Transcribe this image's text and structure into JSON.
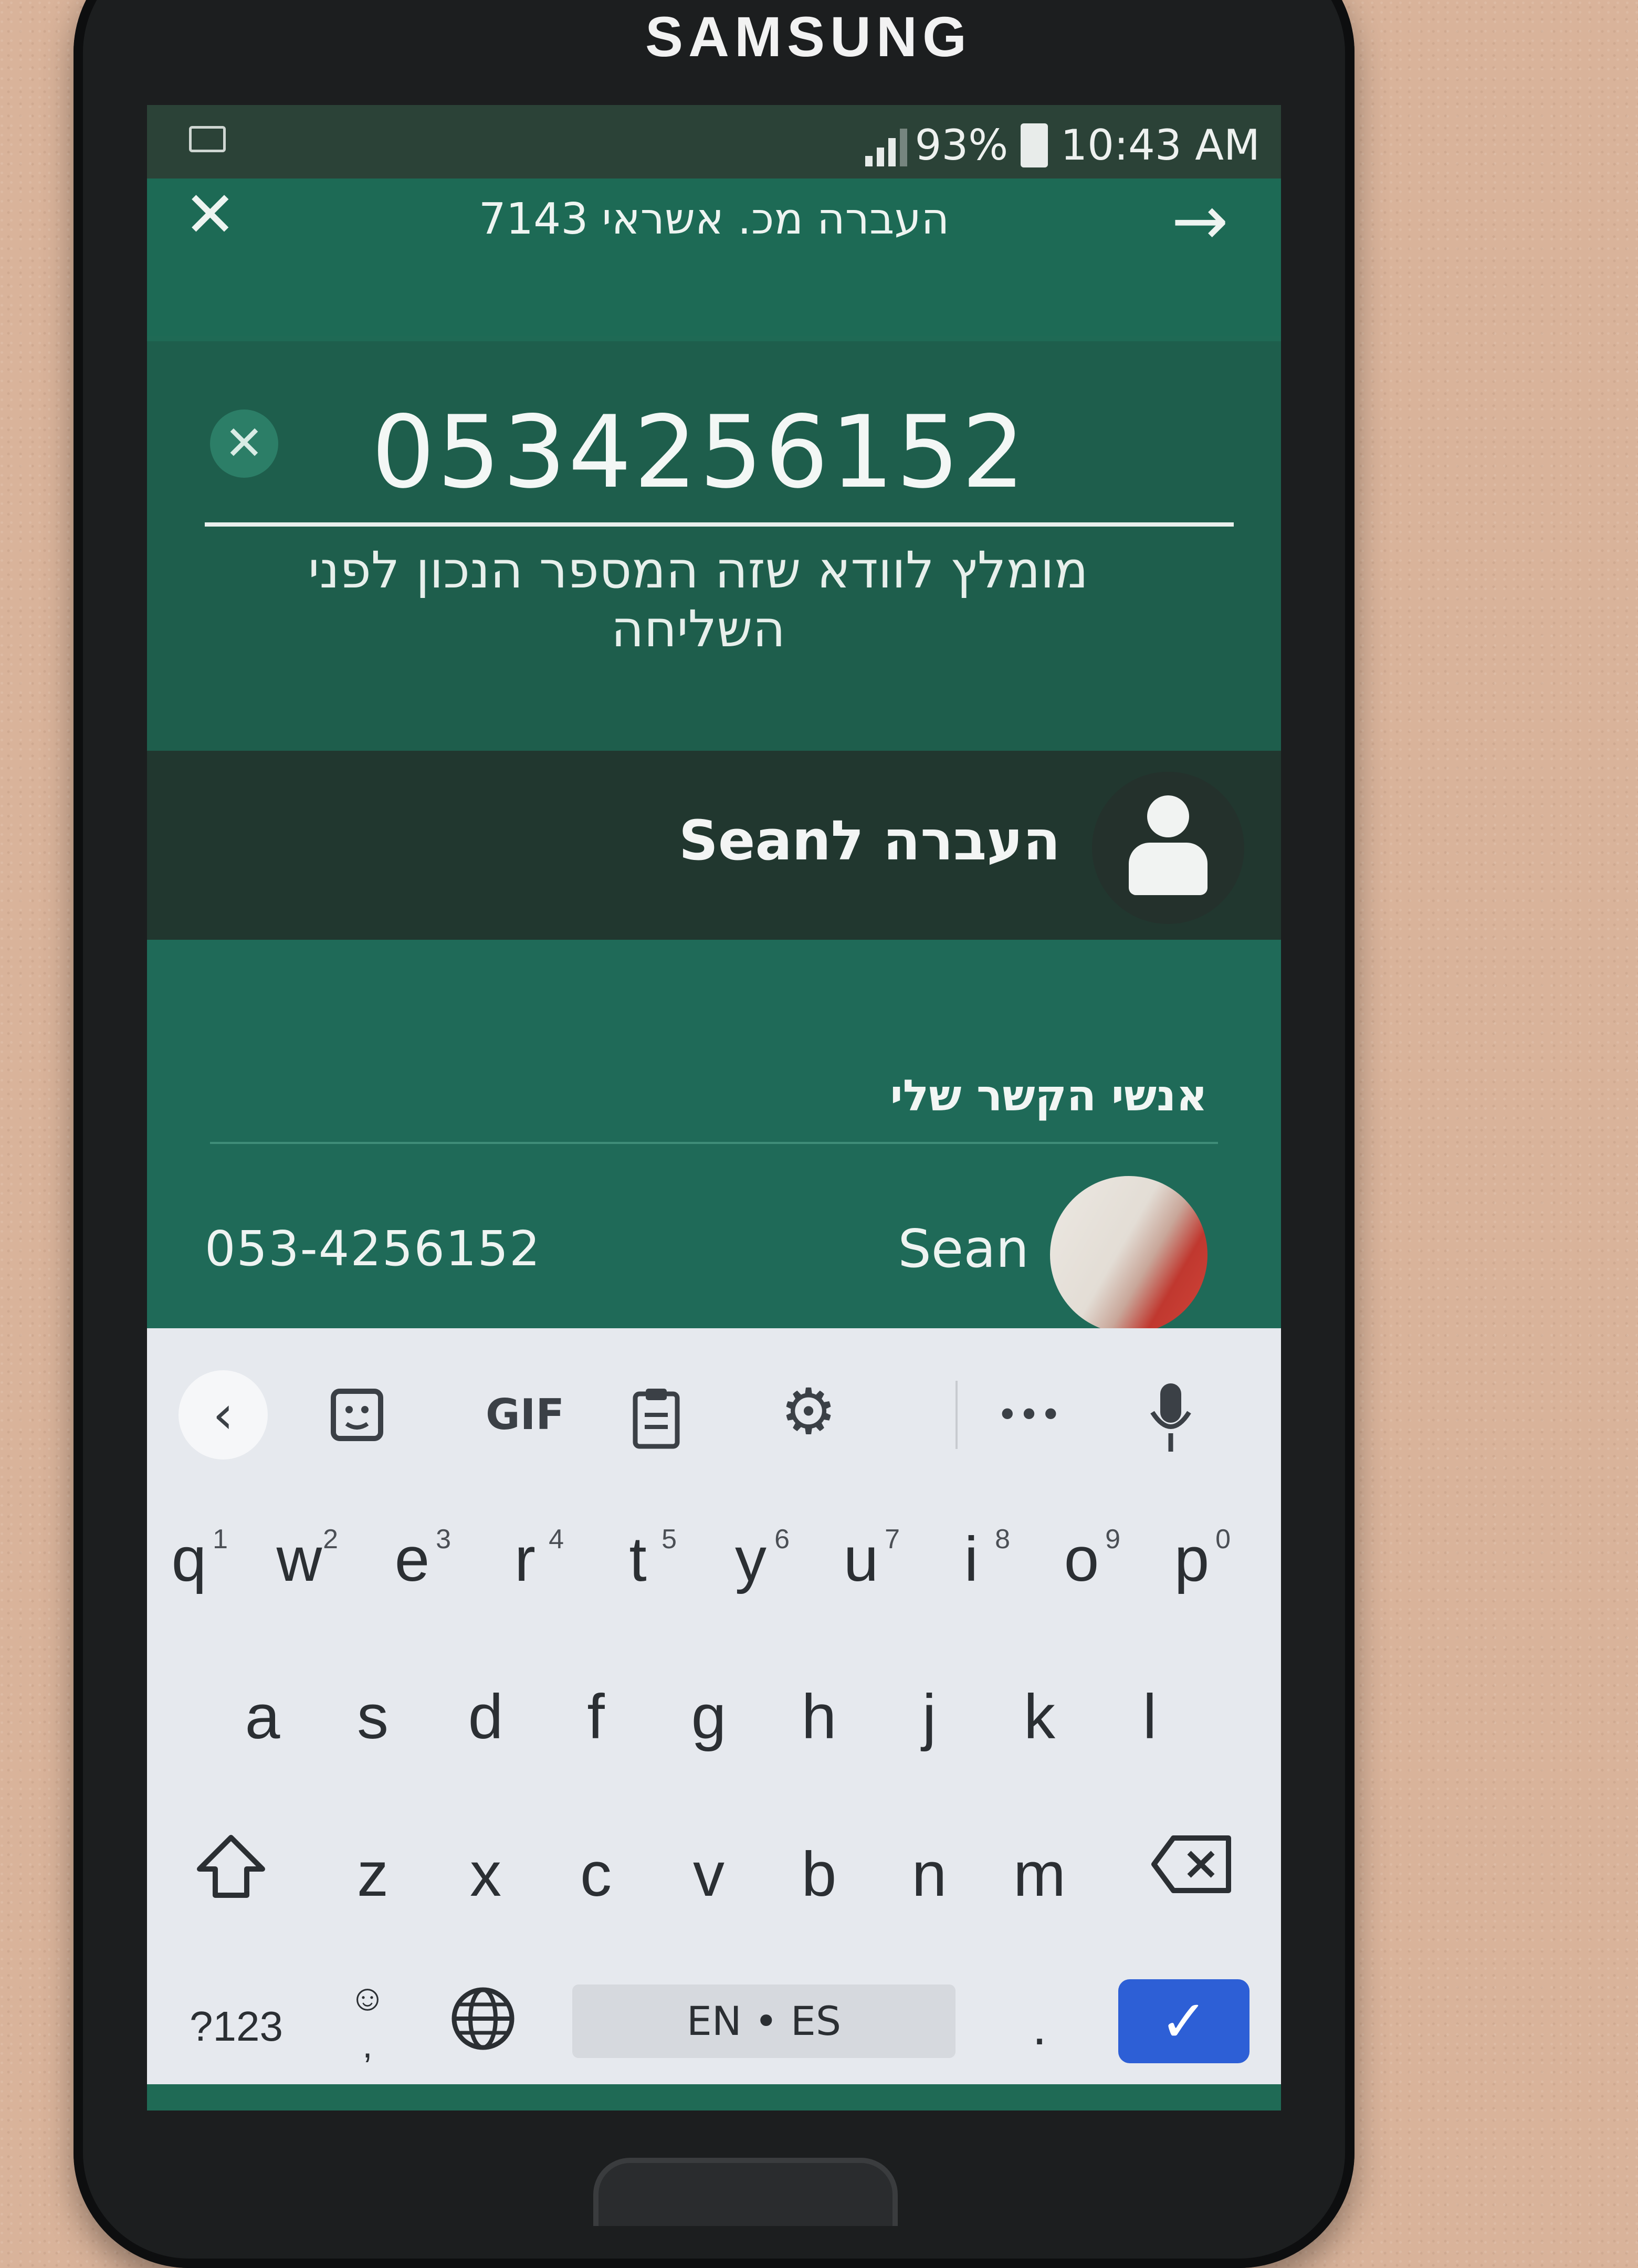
{
  "device": {
    "brand": "SAMSUNG"
  },
  "status_bar": {
    "battery": "93%",
    "time": "10:43 AM",
    "icons": [
      "keyboard-indicator-icon",
      "wifi-icon",
      "signal-icon",
      "battery-icon"
    ]
  },
  "header": {
    "title": "העברה מכ. אשראי 7143",
    "close_icon": "close-icon",
    "forward_icon": "arrow-right-icon"
  },
  "phone_field": {
    "value": "0534256152",
    "clear_icon": "clear-icon",
    "hint": "מומלץ לוודא שזה המספר הנכון לפני השליחה"
  },
  "transfer": {
    "label": "העברה לSean",
    "avatar_icon": "person-icon"
  },
  "contacts": {
    "title": "אנשי הקשר שלי",
    "items": [
      {
        "name": "Sean",
        "number": "053-4256152"
      }
    ]
  },
  "keyboard": {
    "toolbar": {
      "gif": "GIF",
      "more": "•••"
    },
    "row1": [
      "q",
      "w",
      "e",
      "r",
      "t",
      "y",
      "u",
      "i",
      "o",
      "p"
    ],
    "row1_hints": [
      "1",
      "2",
      "3",
      "4",
      "5",
      "6",
      "7",
      "8",
      "9",
      "0"
    ],
    "row2": [
      "a",
      "s",
      "d",
      "f",
      "g",
      "h",
      "j",
      "k",
      "l"
    ],
    "row3": [
      "z",
      "x",
      "c",
      "v",
      "b",
      "n",
      "m"
    ],
    "symbols": "?123",
    "space": "EN • ES",
    "period": "."
  },
  "colors": {
    "app_green": "#1f6a55",
    "status_bar": "#2b4237",
    "enter_key": "#2d5fd6",
    "keyboard_bg": "#e6e9ee"
  }
}
